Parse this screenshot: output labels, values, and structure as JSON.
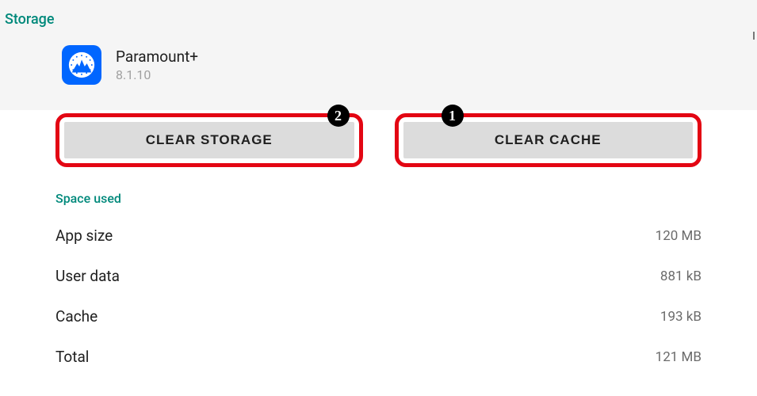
{
  "header": {
    "title": "Storage"
  },
  "app": {
    "name": "Paramount+",
    "version": "8.1.10"
  },
  "buttons": {
    "clear_storage": {
      "label": "CLEAR STORAGE",
      "badge": "2"
    },
    "clear_cache": {
      "label": "CLEAR CACHE",
      "badge": "1"
    }
  },
  "section": {
    "space_used_label": "Space used",
    "rows": [
      {
        "label": "App size",
        "value": "120 MB"
      },
      {
        "label": "User data",
        "value": "881 kB"
      },
      {
        "label": "Cache",
        "value": "193 kB"
      },
      {
        "label": "Total",
        "value": "121 MB"
      }
    ]
  }
}
